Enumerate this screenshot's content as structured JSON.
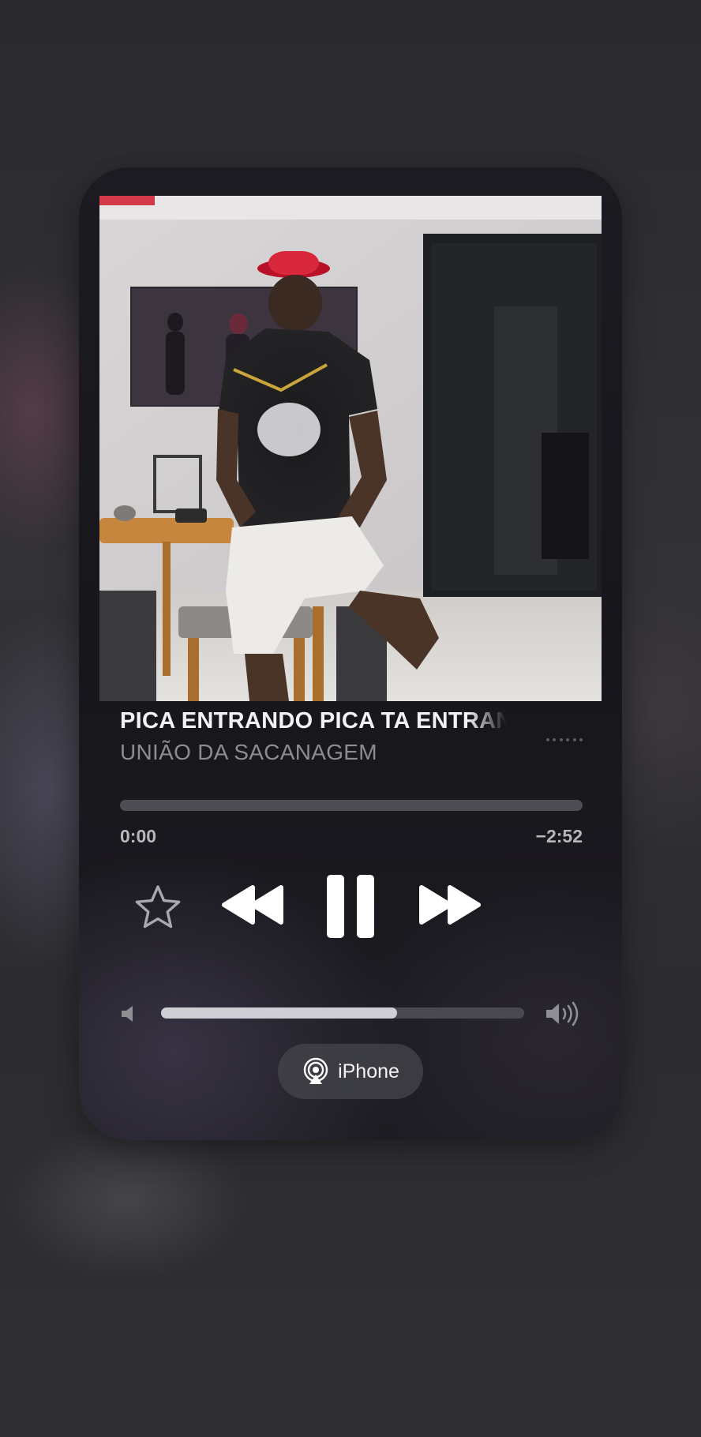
{
  "now_playing": {
    "title": "PICA ENTRANDO PICA TA ENTRAN",
    "artist": "UNIÃO DA SACANAGEM",
    "elapsed": "0:00",
    "remaining": "−2:52",
    "progress_fraction": 0.0,
    "volume_fraction": 0.65
  },
  "icons": {
    "more": "ellipsis-icon",
    "favorite": "star-icon",
    "rewind": "rewind-icon",
    "pause": "pause-icon",
    "forward": "fast-forward-icon",
    "volume_low": "speaker-low-icon",
    "volume_high": "speaker-high-icon",
    "output": "airplay-icon"
  },
  "output_device": {
    "label": "iPhone"
  },
  "colors": {
    "card_bg": "#18171c",
    "text_primary": "#f2f2f4",
    "text_secondary": "#8d8c93",
    "track_bg": "#4e4d54",
    "track_fill": "#cfced5"
  }
}
